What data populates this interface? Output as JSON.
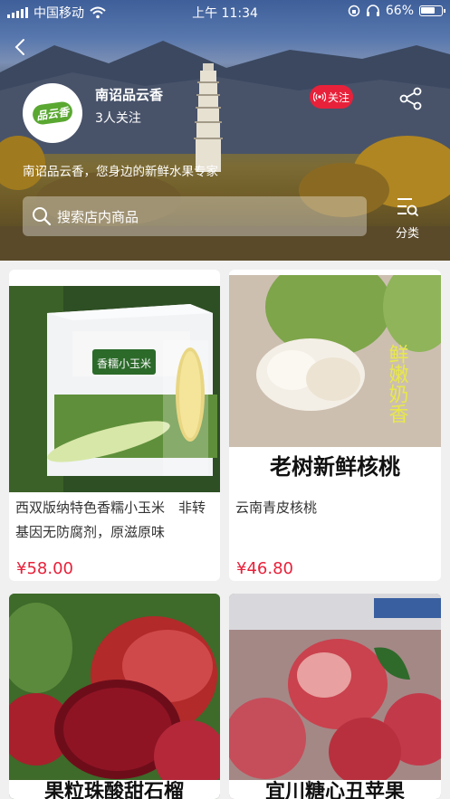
{
  "status_bar": {
    "carrier": "中国移动",
    "time": "上午 11:34",
    "battery": "66%"
  },
  "shop": {
    "name": "南诏品云香",
    "followers": "3人关注",
    "follow_label": "关注",
    "slogan": "南诏品云香，您身边的新鲜水果专家",
    "logo_text": "品云香"
  },
  "search": {
    "placeholder": "搜索店内商品"
  },
  "category_label": "分类",
  "products": [
    {
      "title": "西双版纳特色香糯小玉米　非转基因无防腐剂，原滋原味",
      "price": "¥58.00",
      "image_text": "香糯小玉米"
    },
    {
      "title": "云南青皮核桃",
      "price": "¥46.80",
      "image_text_1": "鲜嫩奶香",
      "image_caption": "老树新鲜核桃"
    },
    {
      "image_caption": "果粒珠酸甜石榴"
    },
    {
      "image_caption": "宜川糖心丑苹果"
    }
  ],
  "colors": {
    "accent": "#e8213a",
    "background": "#f0f0f0"
  }
}
